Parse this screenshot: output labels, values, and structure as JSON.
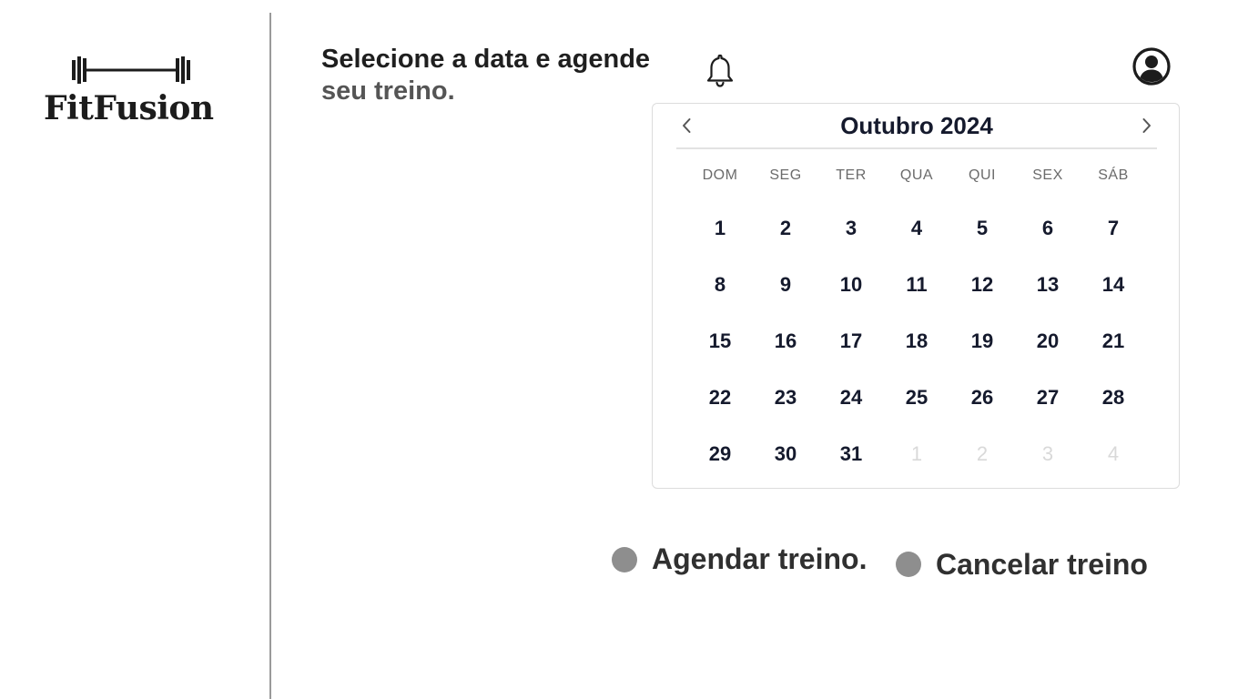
{
  "brand": {
    "name": "FitFusion",
    "logo_icon": "barbell-icon"
  },
  "heading": {
    "line1": "Selecione a data e agende",
    "line2": "seu treino."
  },
  "header_icons": {
    "notifications": "bell-icon",
    "profile": "user-circle-icon"
  },
  "calendar": {
    "title": "Outubro 2024",
    "prev_icon": "chevron-left-icon",
    "next_icon": "chevron-right-icon",
    "weekdays": [
      "DOM",
      "SEG",
      "TER",
      "QUA",
      "QUI",
      "SEX",
      "SÁB"
    ],
    "weeks": [
      [
        "1",
        "2",
        "3",
        "4",
        "5",
        "6",
        "7"
      ],
      [
        "8",
        "9",
        "10",
        "11",
        "12",
        "13",
        "14"
      ],
      [
        "15",
        "16",
        "17",
        "18",
        "19",
        "20",
        "21"
      ],
      [
        "22",
        "23",
        "24",
        "25",
        "26",
        "27",
        "28"
      ],
      [
        "29",
        "30",
        "31",
        "1",
        "2",
        "3",
        "4"
      ]
    ],
    "next_month_days_in_last_week": 4
  },
  "legend": {
    "schedule_label": "Agendar treino.",
    "cancel_label": "Cancelar treino",
    "dot_color": "#8e8e8e"
  }
}
